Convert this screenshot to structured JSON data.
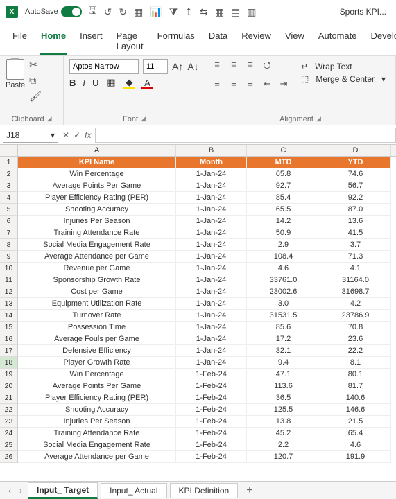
{
  "titlebar": {
    "auto_save": "AutoSave",
    "filename": "Sports KPI..."
  },
  "ribbon_tabs": [
    "File",
    "Home",
    "Insert",
    "Page Layout",
    "Formulas",
    "Data",
    "Review",
    "View",
    "Automate",
    "Develop"
  ],
  "ribbon": {
    "paste": "Paste",
    "clipboard": "Clipboard",
    "font_name": "Aptos Narrow",
    "font_size": "11",
    "font_label": "Font",
    "alignment_label": "Alignment",
    "wrap": "Wrap Text",
    "merge": "Merge & Center"
  },
  "formula": {
    "namebox": "J18",
    "fx": "fx"
  },
  "columns": [
    "A",
    "B",
    "C",
    "D"
  ],
  "chart_data": {
    "type": "table",
    "headers": [
      "KPI Name",
      "Month",
      "MTD",
      "YTD"
    ],
    "rows": [
      [
        "Win Percentage",
        "1-Jan-24",
        "65.8",
        "74.6"
      ],
      [
        "Average Points Per Game",
        "1-Jan-24",
        "92.7",
        "56.7"
      ],
      [
        "Player Efficiency Rating (PER)",
        "1-Jan-24",
        "85.4",
        "92.2"
      ],
      [
        "Shooting Accuracy",
        "1-Jan-24",
        "65.5",
        "87.0"
      ],
      [
        "Injuries Per Season",
        "1-Jan-24",
        "14.2",
        "13.6"
      ],
      [
        "Training Attendance Rate",
        "1-Jan-24",
        "50.9",
        "41.5"
      ],
      [
        "Social Media Engagement Rate",
        "1-Jan-24",
        "2.9",
        "3.7"
      ],
      [
        "Average Attendance per Game",
        "1-Jan-24",
        "108.4",
        "71.3"
      ],
      [
        "Revenue per Game",
        "1-Jan-24",
        "4.6",
        "4.1"
      ],
      [
        "Sponsorship Growth Rate",
        "1-Jan-24",
        "33761.0",
        "31164.0"
      ],
      [
        "Cost per Game",
        "1-Jan-24",
        "23002.6",
        "31698.7"
      ],
      [
        "Equipment Utilization Rate",
        "1-Jan-24",
        "3.0",
        "4.2"
      ],
      [
        "Turnover Rate",
        "1-Jan-24",
        "31531.5",
        "23786.9"
      ],
      [
        "Possession Time",
        "1-Jan-24",
        "85.6",
        "70.8"
      ],
      [
        "Average Fouls per Game",
        "1-Jan-24",
        "17.2",
        "23.6"
      ],
      [
        "Defensive Efficiency",
        "1-Jan-24",
        "32.1",
        "22.2"
      ],
      [
        "Player Growth Rate",
        "1-Jan-24",
        "9.4",
        "8.1"
      ],
      [
        "Win Percentage",
        "1-Feb-24",
        "47.1",
        "80.1"
      ],
      [
        "Average Points Per Game",
        "1-Feb-24",
        "113.6",
        "81.7"
      ],
      [
        "Player Efficiency Rating (PER)",
        "1-Feb-24",
        "36.5",
        "140.6"
      ],
      [
        "Shooting Accuracy",
        "1-Feb-24",
        "125.5",
        "146.6"
      ],
      [
        "Injuries Per Season",
        "1-Feb-24",
        "13.8",
        "21.5"
      ],
      [
        "Training Attendance Rate",
        "1-Feb-24",
        "45.2",
        "65.4"
      ],
      [
        "Social Media Engagement Rate",
        "1-Feb-24",
        "2.2",
        "4.6"
      ],
      [
        "Average Attendance per Game",
        "1-Feb-24",
        "120.7",
        "191.9"
      ]
    ]
  },
  "sheet_tabs": [
    "Input_ Target",
    "Input_ Actual",
    "KPI Definition"
  ]
}
